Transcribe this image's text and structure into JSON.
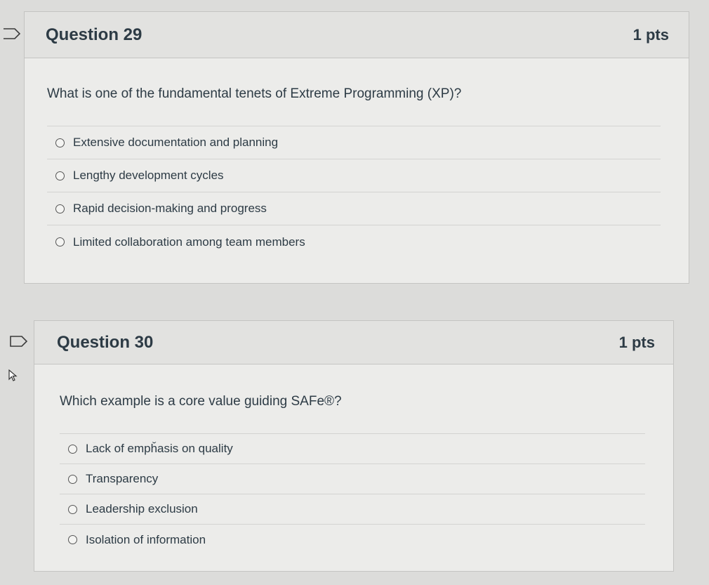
{
  "questions": [
    {
      "title": "Question 29",
      "points": "1 pts",
      "text": "What is one of the fundamental tenets of Extreme Programming (XP)?",
      "answers": [
        "Extensive documentation and planning",
        "Lengthy development cycles",
        "Rapid decision-making and progress",
        "Limited collaboration among team members"
      ]
    },
    {
      "title": "Question 30",
      "points": "1 pts",
      "text": "Which example is a core value guiding SAFe®?",
      "answers": [
        "Lack of empȟasis on quality",
        "Transparency",
        "Leadership exclusion",
        "Isolation of information"
      ]
    }
  ],
  "icons": {
    "flag": "flag-question-icon",
    "cursor": "mouse-pointer-icon"
  }
}
